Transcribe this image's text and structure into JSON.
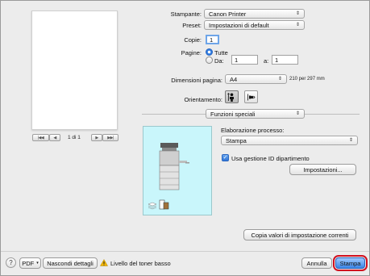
{
  "preview": {
    "page_indicator": "1 di 1",
    "first_label": "|◀◀",
    "prev_label": "◀",
    "next_label": "▶",
    "last_label": "▶▶|"
  },
  "printer": {
    "label": "Stampante:",
    "value": "Canon Printer"
  },
  "preset": {
    "label": "Preset:",
    "value": "Impostazioni di default"
  },
  "copies": {
    "label": "Copie:",
    "value": "1"
  },
  "pages": {
    "label": "Pagine:",
    "all_label": "Tutte",
    "from_label": "Da:",
    "from_value": "1",
    "to_label": "a:",
    "to_value": "1",
    "selected": "Tutte"
  },
  "paper_size": {
    "label": "Dimensioni pagina:",
    "value": "A4",
    "dimensions": "210 per 297 mm"
  },
  "orientation": {
    "label": "Orientamento:",
    "selected": "portrait"
  },
  "section": {
    "value": "Funzioni speciali"
  },
  "processing": {
    "label": "Elaborazione processo:",
    "value": "Stampa"
  },
  "department_id": {
    "label": "Usa gestione ID dipartimento",
    "checked": true
  },
  "buttons": {
    "settings": "Impostazioni...",
    "copy_values": "Copia valori di impostazione correnti",
    "pdf": "PDF",
    "hide_details": "Nascondi dettagli",
    "cancel": "Annulla",
    "print": "Stampa",
    "help": "?"
  },
  "status": {
    "toner": "Livello del toner basso"
  },
  "colors": {
    "preview_bg": "#c9f6fb",
    "accent": "#3a86e8",
    "highlight": "#d01020",
    "warning": "#f2b705"
  },
  "icons": {
    "popup_arrows": "⇕",
    "warning": "warning-triangle-icon",
    "printer": "printer-device-icon",
    "paper_stack": "paper-stack-icon",
    "paper_trays": "paper-trays-icon"
  }
}
